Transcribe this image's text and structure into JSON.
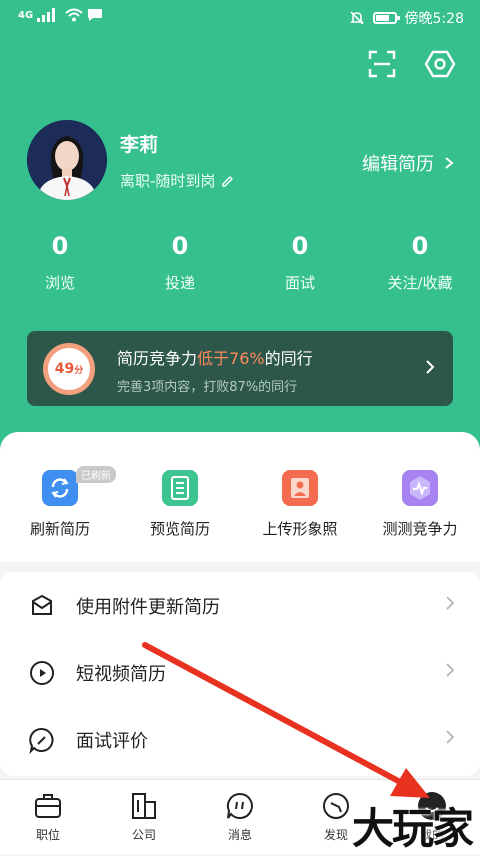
{
  "status_bar": {
    "network": "4G",
    "time_label": "傍晚5:28",
    "battery_level": 0.7
  },
  "profile": {
    "name": "李莉",
    "status": "离职-随时到岗",
    "edit_resume": "编辑简历"
  },
  "stats": [
    {
      "count": "0",
      "label": "浏览"
    },
    {
      "count": "0",
      "label": "投递"
    },
    {
      "count": "0",
      "label": "面试"
    },
    {
      "count": "0",
      "label": "关注/收藏"
    }
  ],
  "competitiveness": {
    "score": "49",
    "score_unit": "分",
    "line1_prefix": "简历竞争力",
    "line1_highlight": "低于76%",
    "line1_suffix": "的同行",
    "line2": "完善3项内容，打败87%的同行"
  },
  "tools": [
    {
      "label": "刷新简历",
      "icon": "refresh-icon",
      "badge": "已刷新"
    },
    {
      "label": "预览简历",
      "icon": "document-icon"
    },
    {
      "label": "上传形象照",
      "icon": "photo-icon"
    },
    {
      "label": "测测竞争力",
      "icon": "pulse-icon"
    }
  ],
  "menu": [
    {
      "label": "使用附件更新简历",
      "icon": "envelope-icon"
    },
    {
      "label": "短视频简历",
      "icon": "play-icon"
    },
    {
      "label": "面试评价",
      "icon": "comment-icon"
    }
  ],
  "tabs": [
    {
      "label": "职位",
      "icon": "briefcase-icon"
    },
    {
      "label": "公司",
      "icon": "building-icon"
    },
    {
      "label": "消息",
      "icon": "message-icon"
    },
    {
      "label": "发现",
      "icon": "compass-icon"
    },
    {
      "label": "我的",
      "icon": "user-icon"
    }
  ],
  "watermark": "大玩家",
  "colors": {
    "brand": "#35c08e",
    "accent": "#ff8a5c",
    "annotation_arrow": "#e8321f"
  }
}
